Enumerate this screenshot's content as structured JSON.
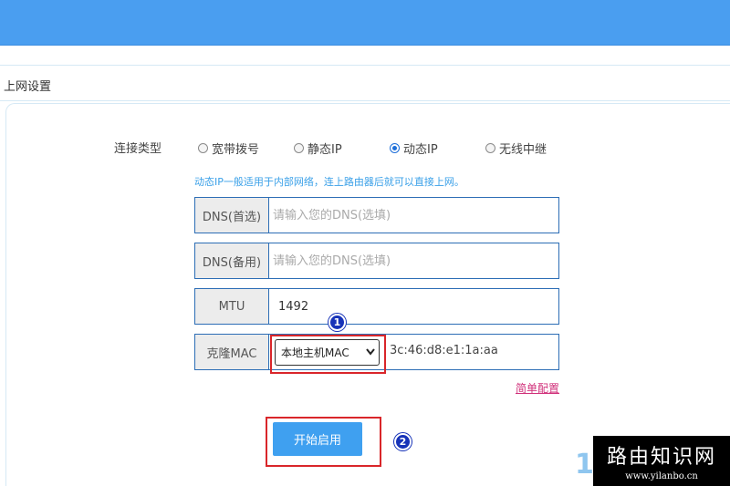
{
  "section": {
    "title": "上网设置"
  },
  "connection": {
    "label": "连接类型",
    "options": [
      {
        "label": "宽带拨号",
        "selected": false
      },
      {
        "label": "静态IP",
        "selected": false
      },
      {
        "label": "动态IP",
        "selected": true
      },
      {
        "label": "无线中继",
        "selected": false
      }
    ],
    "hint": "动态IP一般适用于内部网络，连上路由器后就可以直接上网。"
  },
  "fields": {
    "dns_primary": {
      "label": "DNS(首选)",
      "placeholder": "请输入您的DNS(选填)",
      "value": ""
    },
    "dns_secondary": {
      "label": "DNS(备用)",
      "placeholder": "请输入您的DNS(选填)",
      "value": ""
    },
    "mtu": {
      "label": "MTU",
      "value": "1492"
    },
    "clone_mac": {
      "label": "克隆MAC",
      "selected_option": "本地主机MAC",
      "value": "3c:46:d8:e1:1a:aa"
    }
  },
  "links": {
    "simple_config": "简单配置"
  },
  "buttons": {
    "start": "开始启用"
  },
  "annotations": {
    "badge1": "1",
    "badge2": "2",
    "partial_char": "1"
  },
  "watermark": {
    "title": "路由知识网",
    "url": "www.yilanbo.cn"
  },
  "colors": {
    "topbar": "#4a9ef0",
    "button": "#3fa0f0",
    "highlight": "#d9262a",
    "link": "#d0307a",
    "hint": "#3aa0e8"
  }
}
